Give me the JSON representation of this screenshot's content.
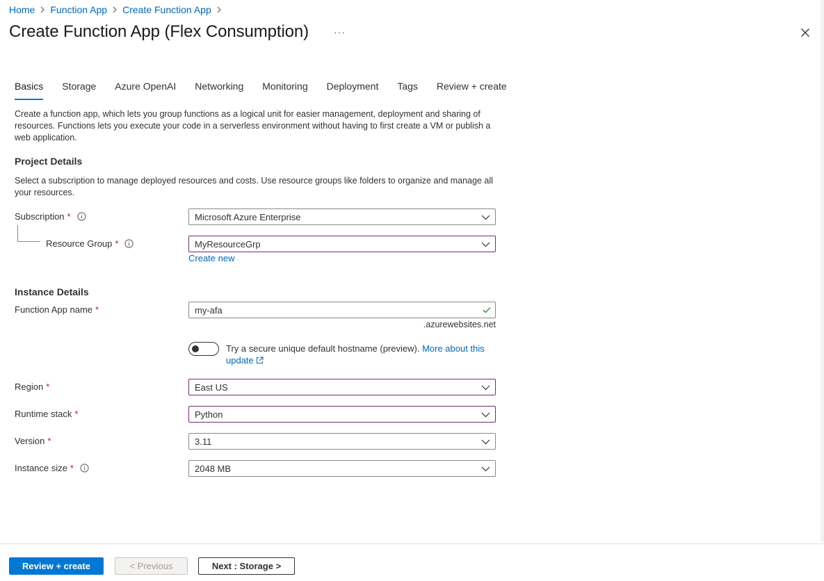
{
  "breadcrumb": {
    "items": [
      "Home",
      "Function App",
      "Create Function App"
    ]
  },
  "header": {
    "title": "Create Function App (Flex Consumption)",
    "more": "···"
  },
  "tabs": [
    {
      "label": "Basics",
      "active": true
    },
    {
      "label": "Storage"
    },
    {
      "label": "Azure OpenAI"
    },
    {
      "label": "Networking"
    },
    {
      "label": "Monitoring"
    },
    {
      "label": "Deployment"
    },
    {
      "label": "Tags"
    },
    {
      "label": "Review + create"
    }
  ],
  "intro": "Create a function app, which lets you group functions as a logical unit for easier management, deployment and sharing of resources. Functions lets you execute your code in a serverless environment without having to first create a VM or publish a web application.",
  "project": {
    "title": "Project Details",
    "description": "Select a subscription to manage deployed resources and costs. Use resource groups like folders to organize and manage all your resources.",
    "subscription_label": "Subscription",
    "subscription_value": "Microsoft Azure Enterprise",
    "resource_group_label": "Resource Group",
    "resource_group_value": "MyResourceGrp",
    "create_new": "Create new"
  },
  "instance": {
    "title": "Instance Details",
    "name_label": "Function App name",
    "name_value": "my-afa",
    "name_suffix": ".azurewebsites.net",
    "toggle_text": "Try a secure unique default hostname (preview).",
    "toggle_link": "More about this update",
    "region_label": "Region",
    "region_value": "East US",
    "runtime_label": "Runtime stack",
    "runtime_value": "Python",
    "version_label": "Version",
    "version_value": "3.11",
    "size_label": "Instance size",
    "size_value": "2048 MB"
  },
  "required_marker": "*",
  "footer": {
    "review_create": "Review + create",
    "previous": "< Previous",
    "next": "Next : Storage >"
  },
  "colors": {
    "accent": "#0078d4",
    "link": "#0067b8",
    "required": "#a4262c",
    "focus_border": "#742774",
    "valid": "#107c10"
  }
}
